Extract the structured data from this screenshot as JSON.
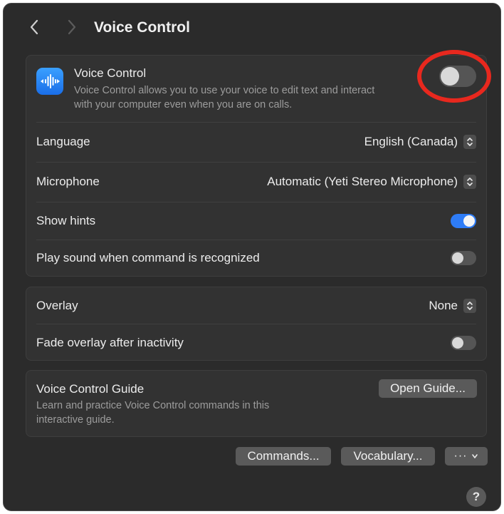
{
  "header": {
    "title": "Voice Control",
    "back_icon": "chevron-left-icon",
    "forward_icon": "chevron-right-icon"
  },
  "main_group": {
    "voice_control": {
      "icon": "waveform-icon",
      "label": "Voice Control",
      "description_line1": "Voice Control allows you to use your voice to edit text and interact",
      "description_line2": "with your computer even when you are on calls.",
      "enabled": false
    },
    "language": {
      "label": "Language",
      "value": "English (Canada)"
    },
    "microphone": {
      "label": "Microphone",
      "value": "Automatic (Yeti Stereo Microphone)"
    },
    "show_hints": {
      "label": "Show hints",
      "enabled": true
    },
    "play_sound": {
      "label": "Play sound when command is recognized",
      "enabled": false
    }
  },
  "overlay_group": {
    "overlay": {
      "label": "Overlay",
      "value": "None"
    },
    "fade_overlay": {
      "label": "Fade overlay after inactivity",
      "enabled": false
    }
  },
  "guide_group": {
    "title": "Voice Control Guide",
    "description_line1": "Learn and practice Voice Control commands in this",
    "description_line2": "interactive guide.",
    "button": "Open Guide..."
  },
  "footer": {
    "commands_button": "Commands...",
    "vocabulary_button": "Vocabulary...",
    "more_button": "···",
    "help_button": "?"
  },
  "colors": {
    "window_bg": "#2b2b2b",
    "group_bg": "#323232",
    "toggle_on": "#2e7cf6",
    "annotation_circle": "#e8281e"
  }
}
